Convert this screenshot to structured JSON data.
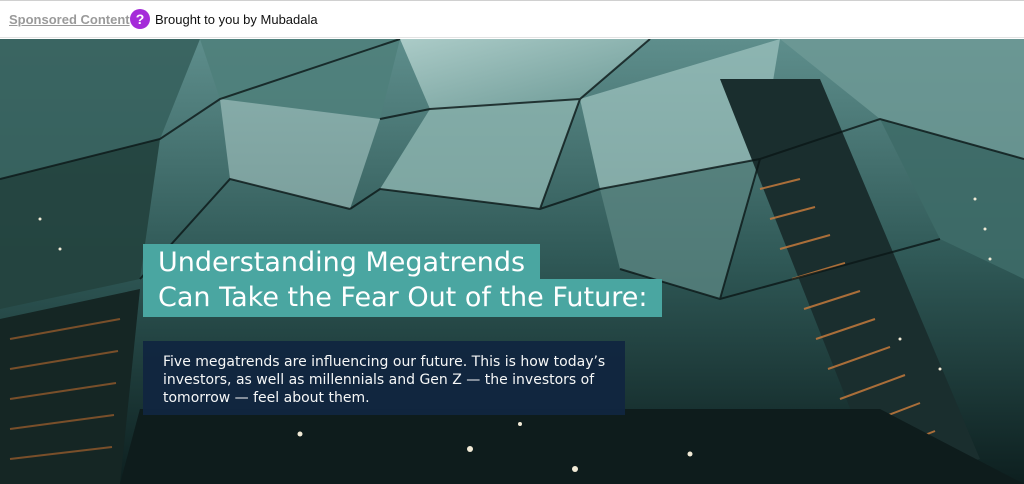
{
  "topbar": {
    "sponsored_label": "Sponsored Content",
    "help_icon": "?",
    "brought_by": "Brought to you by Mubadala"
  },
  "hero": {
    "image": "mirrored-mall-escalators-photo",
    "headline_line1": "Understanding Megatrends",
    "headline_line2": "Can Take the Fear Out of the Future:",
    "description": "Five megatrends are influencing our future. This is how today’s investors, as well as millennials and Gen Z — the investors of tomorrow — feel about them."
  },
  "colors": {
    "headline_bg": "#4aa6a1",
    "description_bg": "#112640",
    "help_icon_bg": "#a52bd9"
  }
}
